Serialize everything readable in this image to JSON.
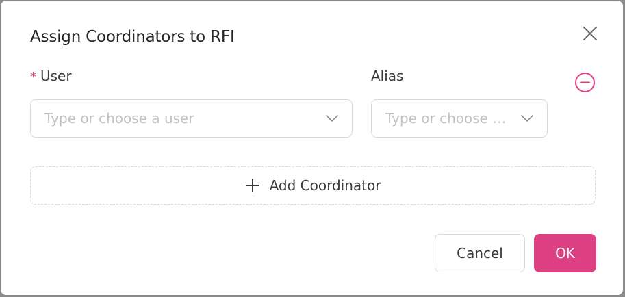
{
  "modal": {
    "title": "Assign Coordinators to RFI"
  },
  "form": {
    "required_mark": "*",
    "user_label": "User",
    "user_placeholder": "Type or choose a user",
    "alias_label": "Alias",
    "alias_placeholder": "Type or choose an alias",
    "add_label": "Add Coordinator"
  },
  "footer": {
    "cancel_label": "Cancel",
    "ok_label": "OK"
  },
  "icons": {
    "close": "close-icon",
    "remove": "minus-circle-icon",
    "chevron": "chevron-down-icon",
    "plus": "plus-icon"
  },
  "colors": {
    "accent": "#dd4183",
    "required": "#e0457b",
    "border": "#d9d9d9",
    "placeholder": "#c2c2c2"
  }
}
